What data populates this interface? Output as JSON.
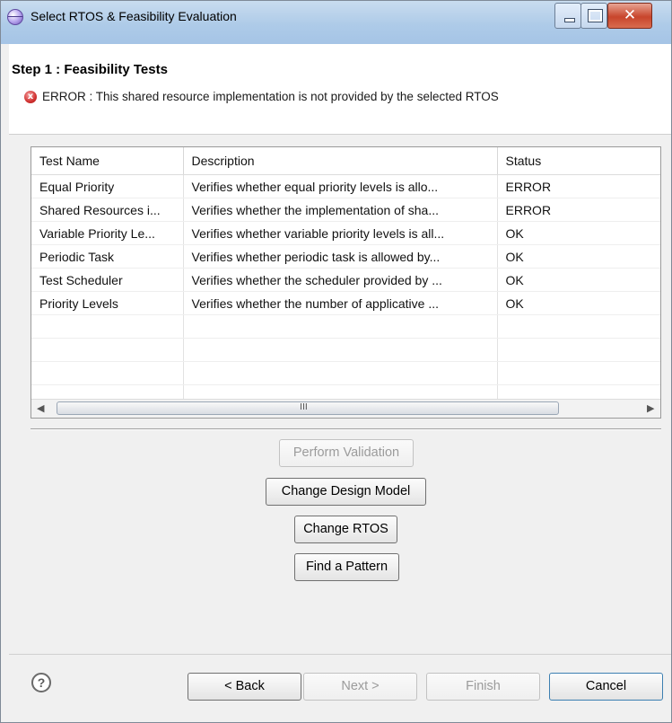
{
  "window": {
    "title": "Select RTOS & Feasibility Evaluation",
    "close_glyph": "✕"
  },
  "header": {
    "step_title": "Step 1 : Feasibility Tests",
    "error_icon": "error-icon",
    "error_glyph": "x",
    "error_message": "ERROR : This shared resource implementation is not provided by the selected RTOS"
  },
  "table": {
    "columns": [
      "Test Name",
      "Description",
      "Status"
    ],
    "rows": [
      {
        "name": "Equal Priority",
        "description": "Verifies whether equal priority levels is allo...",
        "status": "ERROR"
      },
      {
        "name": "Shared Resources i...",
        "description": "Verifies whether the implementation of sha...",
        "status": "ERROR"
      },
      {
        "name": "Variable Priority Le...",
        "description": "Verifies whether variable priority levels is all...",
        "status": "OK"
      },
      {
        "name": "Periodic Task",
        "description": "Verifies whether periodic task is allowed by...",
        "status": "OK"
      },
      {
        "name": "Test Scheduler",
        "description": "Verifies whether the scheduler provided by ...",
        "status": "OK"
      },
      {
        "name": "Priority Levels",
        "description": "Verifies whether the number of applicative ...",
        "status": "OK"
      }
    ],
    "empty_rows": 4,
    "scroll_left_glyph": "◀",
    "scroll_right_glyph": "▶",
    "scroll_grip": "III"
  },
  "actions": {
    "perform_validation": "Perform Validation",
    "change_design_model": "Change Design Model",
    "change_rtos": "Change RTOS",
    "find_pattern": "Find a Pattern"
  },
  "footer": {
    "help_glyph": "?",
    "back": "< Back",
    "next": "Next >",
    "finish": "Finish",
    "cancel": "Cancel"
  }
}
